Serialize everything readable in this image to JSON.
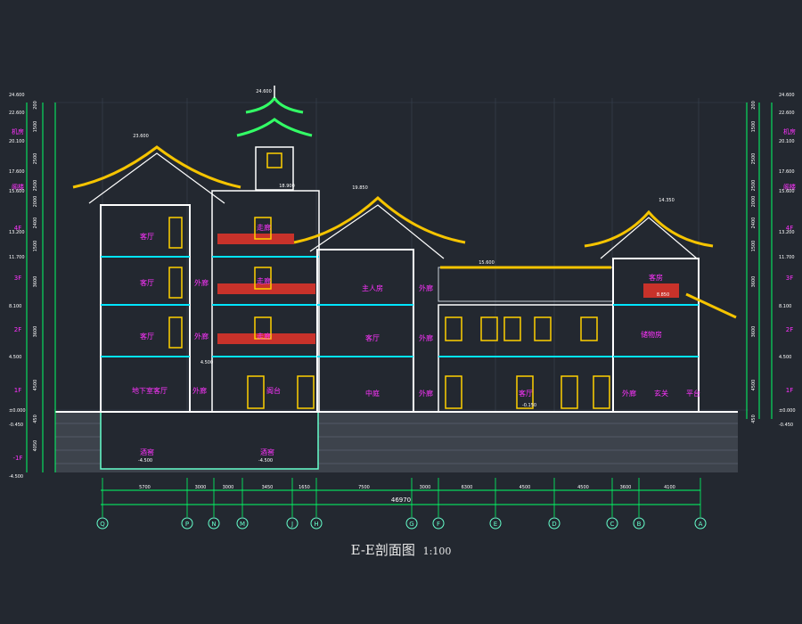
{
  "colors": {
    "background": "#232830",
    "grid": "#3a4250",
    "wall": "#ffffff",
    "roof": "#f5c400",
    "structure": "#00e5ff",
    "room_label": "#ff33ff",
    "dimension": "#00ff66",
    "axis": "#66ffcc",
    "railing": "#c8322a",
    "window": "#ffd000",
    "ground_hatch": "#6b7280"
  },
  "title": {
    "main": "E-E剖面图",
    "scale": "1:100"
  },
  "rooms": [
    "客厅",
    "客厅",
    "客厅",
    "地下室客厅",
    "外廊",
    "外廊",
    "外廊",
    "走廊",
    "走廊",
    "走廊",
    "阁台",
    "主人房",
    "客厅",
    "中庭",
    "外廊",
    "外廊",
    "外廊",
    "客厅",
    "客房",
    "储物房",
    "外廊",
    "玄关",
    "平台",
    "酒窖",
    "酒窖"
  ],
  "floors": [
    "机房",
    "阁楼",
    "4F",
    "3F",
    "2F",
    "1F",
    "-1F"
  ],
  "levels_left": [
    "24.600",
    "22.600",
    "20.100",
    "17.600",
    "15.600",
    "13.200",
    "11.700",
    "8.100",
    "4.500",
    "±0.000",
    "-0.450",
    "-4.500"
  ],
  "levels_right": [
    "24.600",
    "22.600",
    "20.100",
    "17.600",
    "15.600",
    "13.200",
    "11.700",
    "8.100",
    "4.500",
    "±0.000",
    "-0.450"
  ],
  "elevation_tags": [
    "24.600",
    "23.600",
    "18.900",
    "19.850",
    "14.350",
    "15.600",
    "8.850",
    "4.500",
    "-0.150",
    "-4.500",
    "-4.500"
  ],
  "vertical_dims": [
    "200",
    "1500",
    "2500",
    "2500",
    "2000",
    "2400",
    "1500",
    "3600",
    "3600",
    "4500",
    "450",
    "4050"
  ],
  "grid_axes": [
    "Q",
    "P",
    "N",
    "M",
    "J",
    "H",
    "G",
    "F",
    "E",
    "D",
    "C",
    "B",
    "A"
  ],
  "bay_dims": [
    "5700",
    "3000",
    "3000",
    "3450",
    "1650",
    "7500",
    "3000",
    "6300",
    "4500",
    "4500",
    "3600",
    "4100",
    "500"
  ],
  "overall_dim": "46970"
}
